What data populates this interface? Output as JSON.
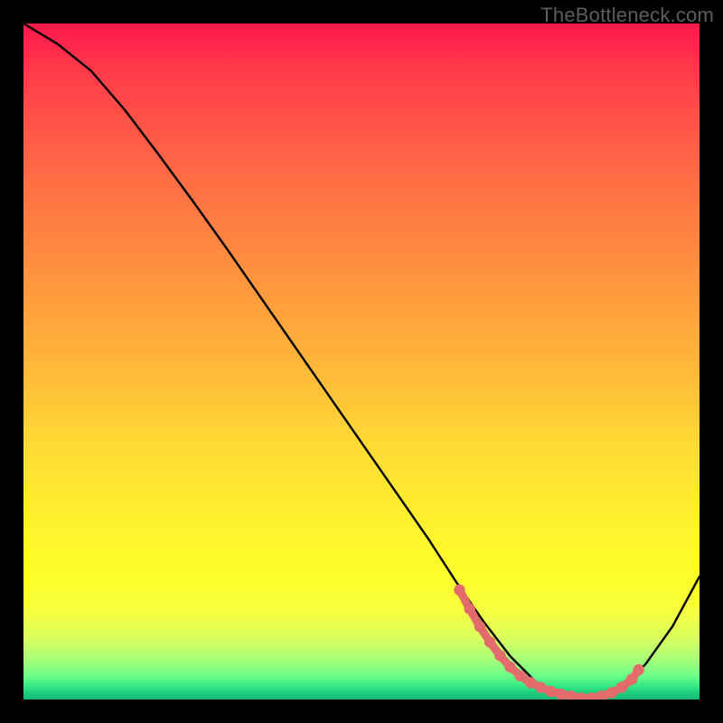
{
  "watermark": "TheBottleneck.com",
  "chart_data": {
    "type": "line",
    "title": "",
    "xlabel": "",
    "ylabel": "",
    "xlim": [
      0,
      100
    ],
    "ylim": [
      0,
      100
    ],
    "grid": false,
    "legend": false,
    "series": [
      {
        "name": "bottleneck-curve",
        "stroke": "#000000",
        "x": [
          0,
          5,
          10,
          15,
          20,
          25,
          30,
          35,
          40,
          45,
          50,
          55,
          60,
          64,
          68,
          72,
          76,
          80,
          84,
          88,
          92,
          96,
          100
        ],
        "y": [
          100,
          97,
          93,
          87.2,
          80.6,
          73.8,
          66.8,
          59.6,
          52.4,
          45.2,
          38,
          30.8,
          23.6,
          17.4,
          11.6,
          6.4,
          2.4,
          0.4,
          0.2,
          1.6,
          5.2,
          10.8,
          18.2
        ]
      },
      {
        "name": "optimal-range-markers",
        "stroke": "#e36b6b",
        "marker": "circle",
        "x": [
          64.5,
          66,
          67.5,
          69,
          70.5,
          72,
          73.5,
          75,
          76.5,
          78,
          79.5,
          81,
          82.5,
          84,
          85.5,
          87,
          88.5,
          90,
          91
        ],
        "y": [
          16.2,
          13.4,
          10.8,
          8.5,
          6.5,
          4.8,
          3.5,
          2.5,
          1.8,
          1.2,
          0.8,
          0.5,
          0.2,
          0.2,
          0.5,
          1.0,
          1.8,
          3.0,
          4.4
        ]
      }
    ],
    "background_gradient": {
      "direction": "vertical",
      "stops": [
        {
          "pos": 0.0,
          "color": "#ff1a4d"
        },
        {
          "pos": 0.5,
          "color": "#ffb53a"
        },
        {
          "pos": 0.82,
          "color": "#ffff2a"
        },
        {
          "pos": 1.0,
          "color": "#16b877"
        }
      ]
    }
  }
}
